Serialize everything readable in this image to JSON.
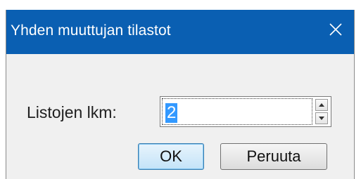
{
  "dialog": {
    "title": "Yhden muuttujan tilastot",
    "field_label": "Listojen lkm:",
    "field_value": "2",
    "ok_label": "OK",
    "cancel_label": "Peruuta"
  },
  "colors": {
    "titlebar": "#0a5fb2",
    "selection": "#3399ff",
    "dialog_background": "#f0f0f0"
  },
  "icons": {
    "close": "close-icon",
    "spin_up": "triangle-up-icon",
    "spin_down": "triangle-down-icon"
  }
}
